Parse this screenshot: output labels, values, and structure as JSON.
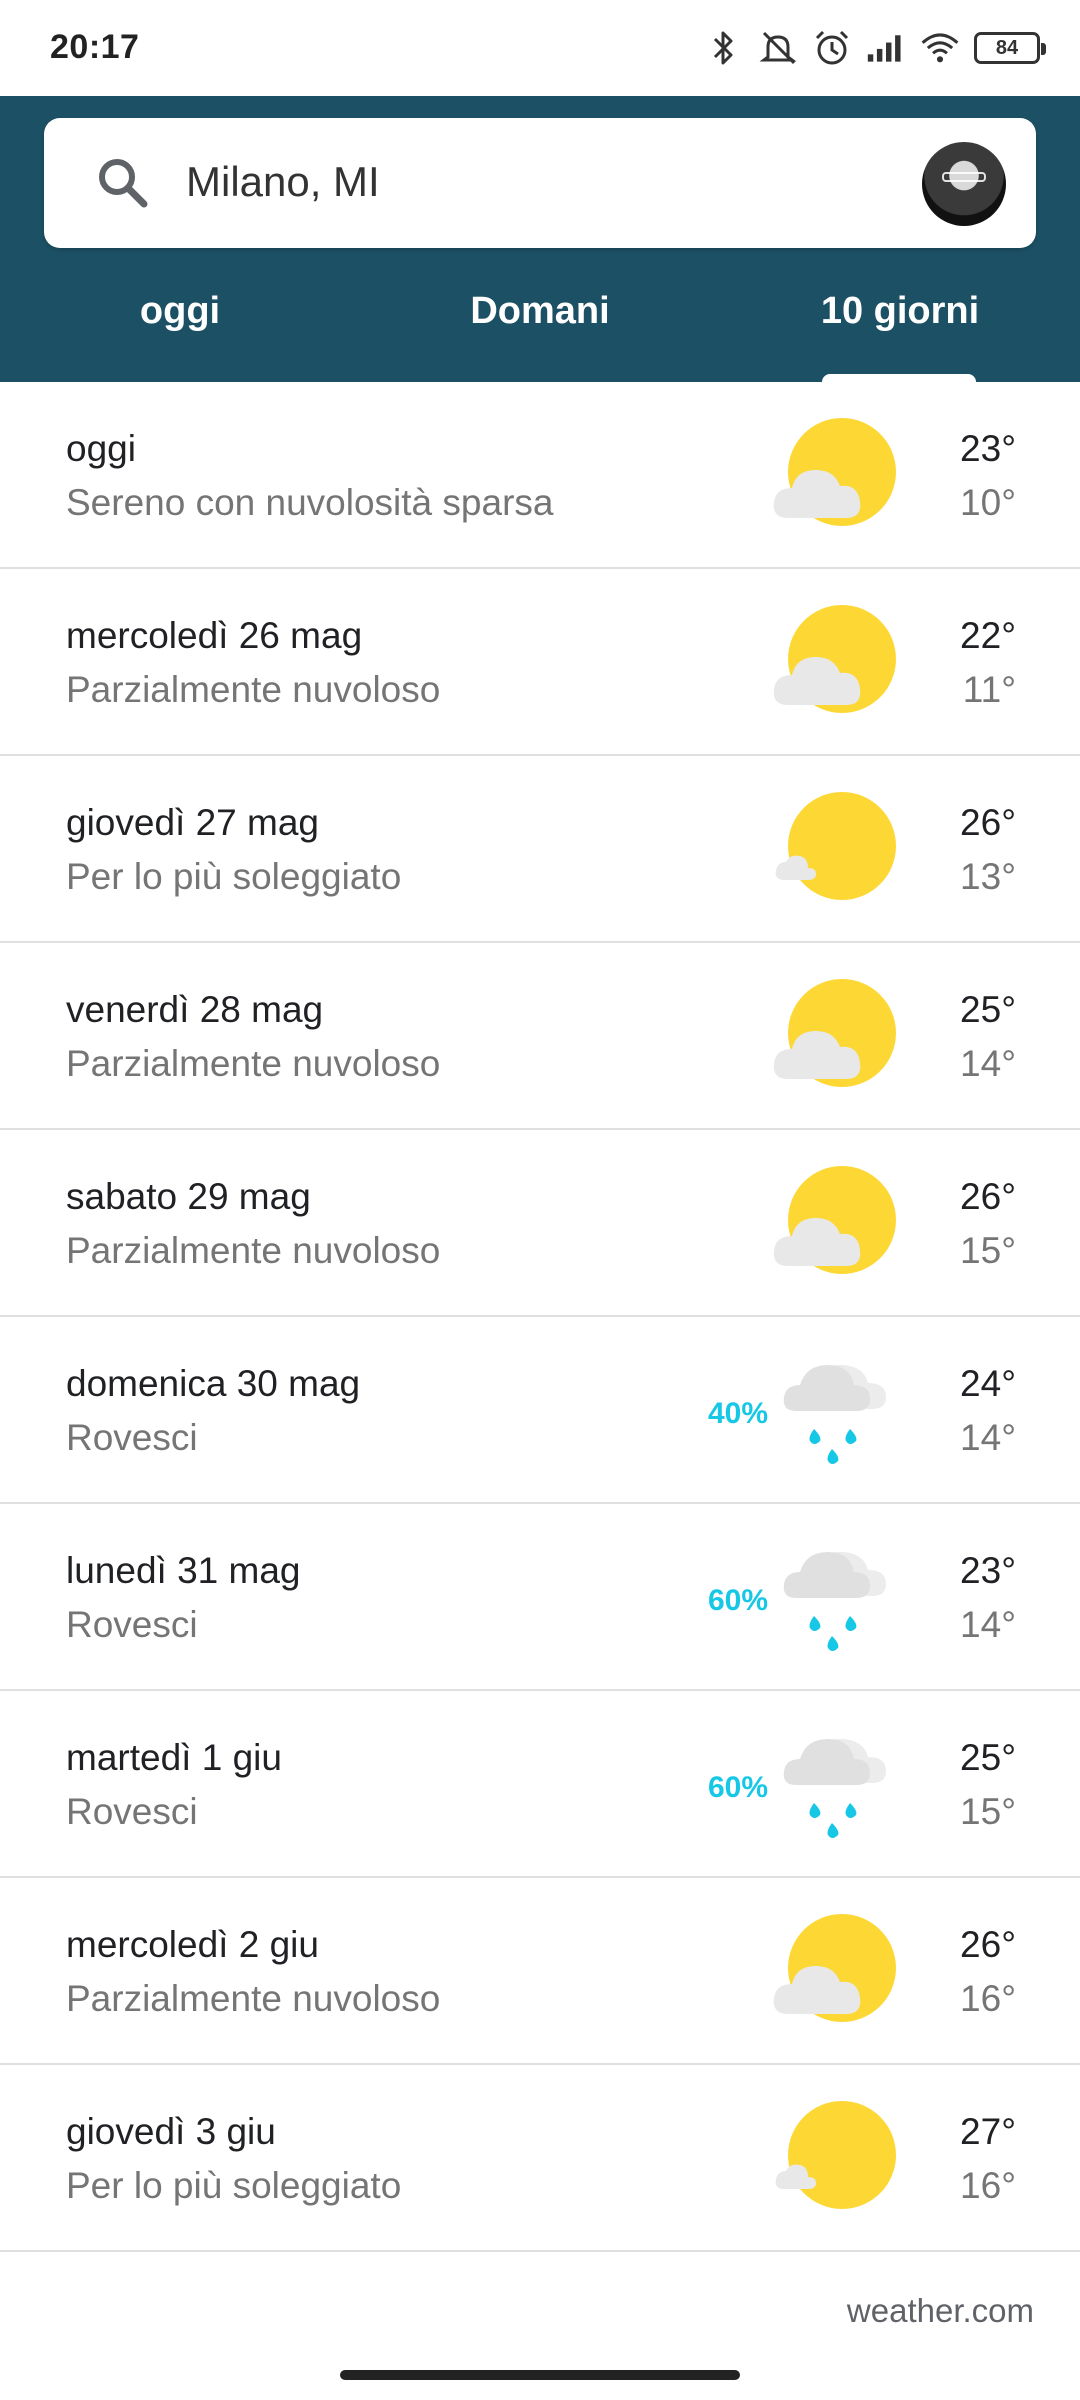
{
  "status_bar": {
    "time": "20:17",
    "battery": "84",
    "icons": [
      "bluetooth-icon",
      "mute-icon",
      "alarm-icon",
      "signal-icon",
      "wifi-icon",
      "battery-icon"
    ]
  },
  "search": {
    "location": "Milano, MI"
  },
  "tabs": [
    "oggi",
    "Domani",
    "10 giorni"
  ],
  "active_tab": "10 giorni",
  "colors": {
    "header": "#1c5064",
    "sun": "#fdd835",
    "cloud": "#e8e8e8",
    "rain": "#16c8e6"
  },
  "forecast": [
    {
      "day": "oggi",
      "condition": "Sereno con nuvolosità sparsa",
      "icon": "partly-cloudy-icon",
      "precip": "",
      "high": "23°",
      "low": "10°"
    },
    {
      "day": "mercoledì 26 mag",
      "condition": "Parzialmente nuvoloso",
      "icon": "partly-cloudy-icon",
      "precip": "",
      "high": "22°",
      "low": "11°"
    },
    {
      "day": "giovedì 27 mag",
      "condition": "Per lo più soleggiato",
      "icon": "mostly-sunny-icon",
      "precip": "",
      "high": "26°",
      "low": "13°"
    },
    {
      "day": "venerdì 28 mag",
      "condition": "Parzialmente nuvoloso",
      "icon": "partly-cloudy-icon",
      "precip": "",
      "high": "25°",
      "low": "14°"
    },
    {
      "day": "sabato 29 mag",
      "condition": "Parzialmente nuvoloso",
      "icon": "partly-cloudy-icon",
      "precip": "",
      "high": "26°",
      "low": "15°"
    },
    {
      "day": "domenica 30 mag",
      "condition": "Rovesci",
      "icon": "showers-icon",
      "precip": "40%",
      "high": "24°",
      "low": "14°"
    },
    {
      "day": "lunedì 31 mag",
      "condition": "Rovesci",
      "icon": "showers-icon",
      "precip": "60%",
      "high": "23°",
      "low": "14°"
    },
    {
      "day": "martedì 1 giu",
      "condition": "Rovesci",
      "icon": "showers-icon",
      "precip": "60%",
      "high": "25°",
      "low": "15°"
    },
    {
      "day": "mercoledì 2 giu",
      "condition": "Parzialmente nuvoloso",
      "icon": "partly-cloudy-icon",
      "precip": "",
      "high": "26°",
      "low": "16°"
    },
    {
      "day": "giovedì 3 giu",
      "condition": "Per lo più soleggiato",
      "icon": "mostly-sunny-icon",
      "precip": "",
      "high": "27°",
      "low": "16°"
    }
  ],
  "source": "weather.com"
}
